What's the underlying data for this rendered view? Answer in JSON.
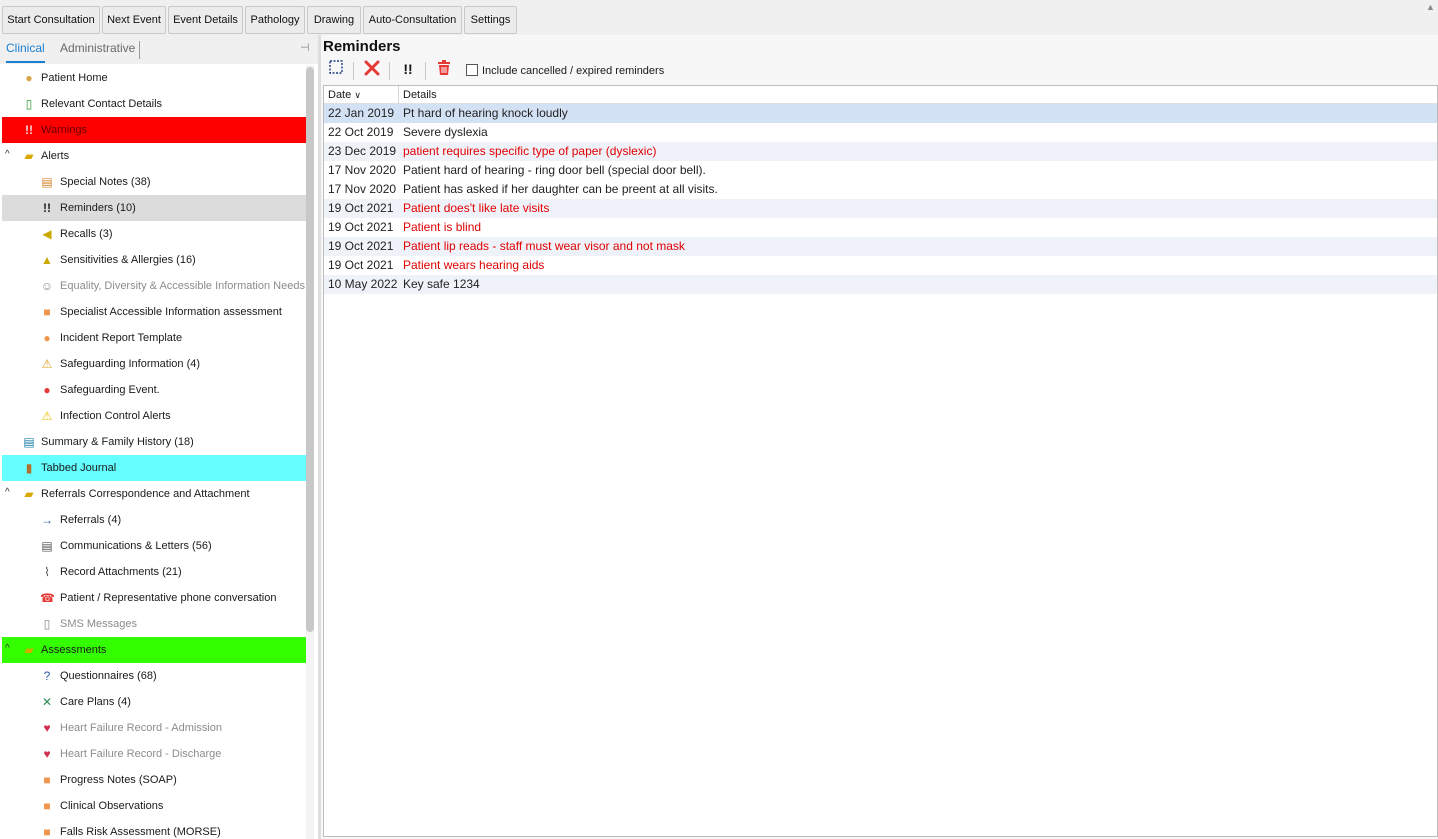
{
  "toolbar": {
    "buttons": [
      "Start Consultation",
      "Next Event",
      "Event Details",
      "Pathology",
      "Drawing",
      "Auto-Consultation",
      "Settings"
    ]
  },
  "left": {
    "tabs": [
      "Clinical",
      "Administrative"
    ],
    "tree": [
      {
        "label": "Patient Home",
        "icon": "person-icon"
      },
      {
        "label": "Relevant Contact Details",
        "icon": "phone-device-icon"
      },
      {
        "label": "Warnings",
        "icon": "exclamation-icon",
        "highlight": "#ff0000"
      },
      {
        "label": "Alerts",
        "icon": "folder-icon",
        "expanded": true
      },
      {
        "label": "Special Notes (38)",
        "icon": "note-icon"
      },
      {
        "label": "Reminders (10)",
        "icon": "double-exclamation-icon",
        "selected": true
      },
      {
        "label": "Recalls (3)",
        "icon": "megaphone-icon"
      },
      {
        "label": "Sensitivities & Allergies (16)",
        "icon": "allergy-icon"
      },
      {
        "label": "Equality, Diversity & Accessible Information Needs",
        "icon": "person-outline-icon",
        "disabled": true
      },
      {
        "label": "Specialist Accessible Information assessment",
        "icon": "orange-square-icon"
      },
      {
        "label": "Incident Report Template",
        "icon": "orange-circle-icon"
      },
      {
        "label": "Safeguarding Information (4)",
        "icon": "safeguarding-icon"
      },
      {
        "label": "Safeguarding Event.",
        "icon": "red-alert-icon"
      },
      {
        "label": "Infection Control Alerts",
        "icon": "warning-triangle-icon"
      },
      {
        "label": "Summary & Family History (18)",
        "icon": "book-icon"
      },
      {
        "label": "Tabbed Journal",
        "icon": "journal-icon",
        "highlight": "#66ffff"
      },
      {
        "label": "Referrals Correspondence and Attachment",
        "icon": "folder-icon",
        "expanded": true
      },
      {
        "label": "Referrals (4)",
        "icon": "arrow-right-icon"
      },
      {
        "label": "Communications & Letters (56)",
        "icon": "document-icon"
      },
      {
        "label": "Record Attachments (21)",
        "icon": "paperclip-icon"
      },
      {
        "label": "Patient / Representative phone conversation",
        "icon": "telephone-icon"
      },
      {
        "label": "SMS Messages",
        "icon": "mobile-icon",
        "disabled": true
      },
      {
        "label": "Assessments",
        "icon": "folder-icon",
        "expanded": true,
        "highlight": "#33ff00"
      },
      {
        "label": "Questionnaires (68)",
        "icon": "question-icon"
      },
      {
        "label": "Care Plans (4)",
        "icon": "care-plan-icon"
      },
      {
        "label": "Heart Failure Record - Admission",
        "icon": "heart-icon",
        "disabled": true
      },
      {
        "label": "Heart Failure Record - Discharge",
        "icon": "heart-icon",
        "disabled": true
      },
      {
        "label": "Progress Notes (SOAP)",
        "icon": "orange-square-icon"
      },
      {
        "label": "Clinical Observations",
        "icon": "orange-square-icon"
      },
      {
        "label": "Falls Risk Assessment (MORSE)",
        "icon": "orange-square-icon"
      }
    ]
  },
  "main": {
    "title": "Reminders",
    "include_cancelled_label": "Include cancelled / expired reminders",
    "columns": [
      "Date",
      "Details"
    ],
    "rows": [
      {
        "date": "22 Jan 2019",
        "details": "Pt hard of hearing knock loudly",
        "red": false
      },
      {
        "date": "22 Oct 2019",
        "details": "Severe dyslexia",
        "red": false
      },
      {
        "date": "23 Dec 2019",
        "details": "patient requires specific type of paper (dyslexic)",
        "red": true
      },
      {
        "date": "17 Nov 2020",
        "details": "Patient hard of hearing - ring door bell (special door bell).",
        "red": false
      },
      {
        "date": "17 Nov 2020",
        "details": "Patient has asked if her daughter can be preent at all visits.",
        "red": false
      },
      {
        "date": "19 Oct 2021",
        "details": "Patient does't like late visits",
        "red": true
      },
      {
        "date": "19 Oct 2021",
        "details": "Patient is blind",
        "red": true
      },
      {
        "date": "19 Oct 2021",
        "details": "Patient lip reads - staff must wear visor and not mask",
        "red": true
      },
      {
        "date": "19 Oct 2021",
        "details": "Patient wears hearing aids",
        "red": true
      },
      {
        "date": "10 May 2022",
        "details": "Key safe 1234",
        "red": false
      }
    ]
  }
}
